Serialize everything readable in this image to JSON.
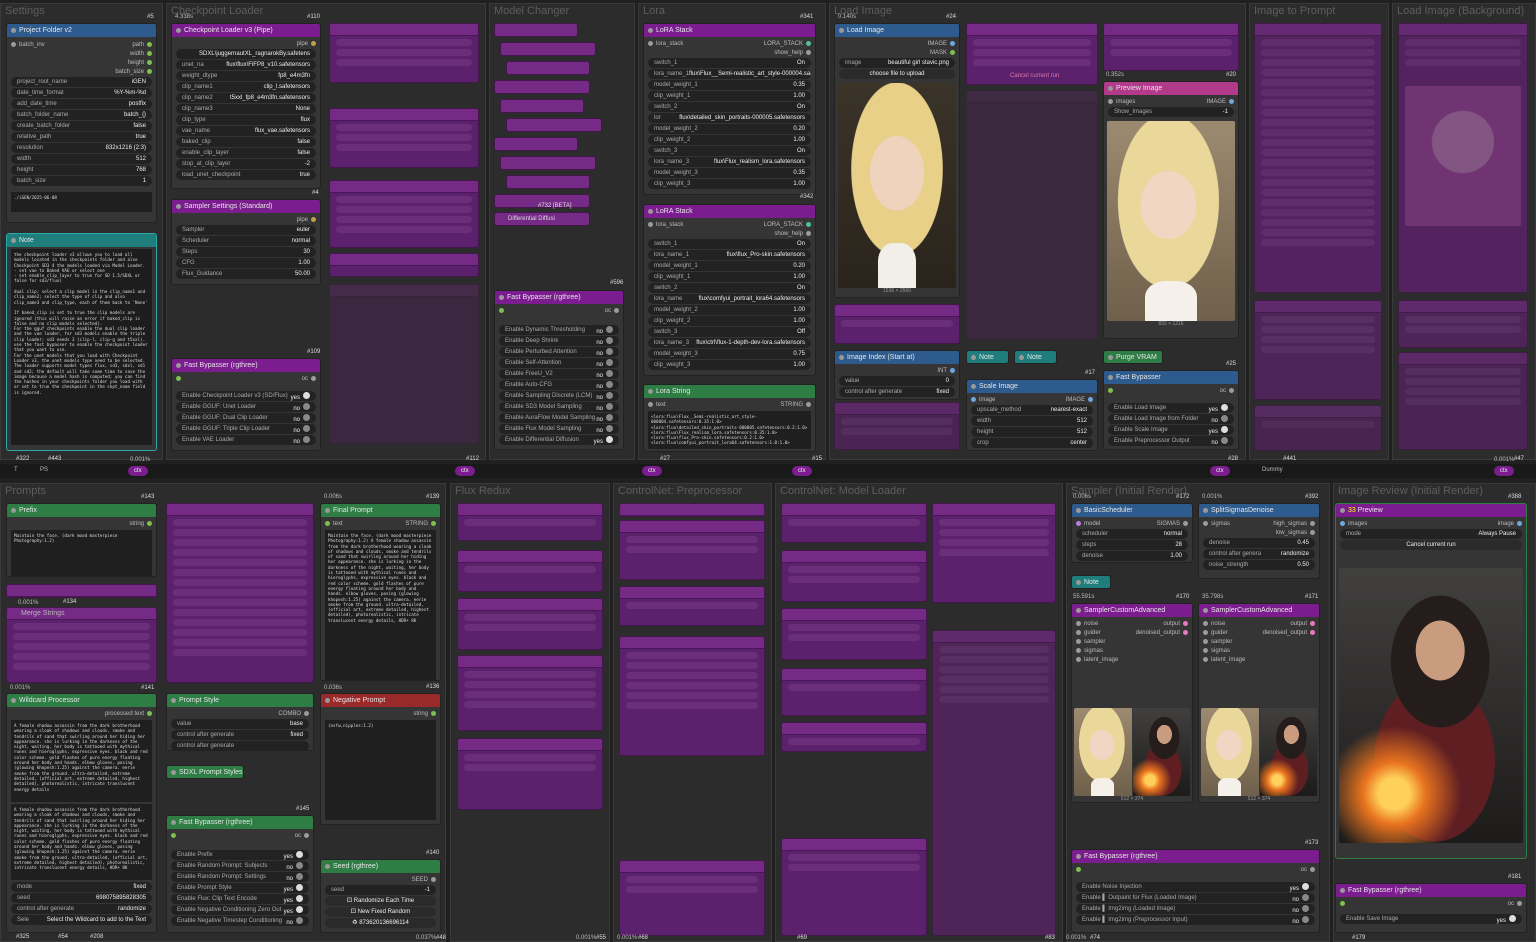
{
  "groups": {
    "settings": "Settings",
    "checkpoint_loader": "Checkpoint Loader",
    "model_changer": "Model Changer",
    "lora": "Lora",
    "load_image": "Load Image",
    "image_to_prompt": "Image to Prompt",
    "load_image_bg": "Load Image (Background)",
    "prompts": "Prompts",
    "flux_redux": "Flux Redux",
    "controlnet_pre": "ControlNet: Preprocessor",
    "controlnet_loader": "ControlNet: Model Loader",
    "sampler_initial": "Sampler (Initial Render)",
    "image_review": "Image Review (Initial Render)"
  },
  "project_folder": {
    "title": "Project Folder v2",
    "badge": "#5",
    "outputs": [
      "path",
      "width",
      "height",
      "batch_size"
    ],
    "input": "batch_inv",
    "widgets": [
      {
        "k": "project_root_name",
        "v": "iGEN"
      },
      {
        "k": "date_time_format",
        "v": "%Y-%m-%d"
      },
      {
        "k": "add_date_time",
        "v": "postfix"
      },
      {
        "k": "batch_folder_name",
        "v": "batch_{}"
      },
      {
        "k": "create_batch_folder",
        "v": "false"
      },
      {
        "k": "relative_path",
        "v": "true"
      },
      {
        "k": "resolution",
        "v": "832x1216 (2:3)"
      },
      {
        "k": "width",
        "v": "512"
      },
      {
        "k": "height",
        "v": "768"
      },
      {
        "k": "batch_size",
        "v": "1"
      }
    ],
    "path_preview": "./iGEN/2025-06-08"
  },
  "note_left": {
    "title": "Note",
    "text": "the checkpoint loader v3 allows you to load all models located in the checkpoints folder and also Checkpoint SD3 4 the models loaded via Model Loader.\n- set vae to Baked VAE or select one\n- set enable_clip_layer to true for SD 1.5/SDXL or false for sd3/flux)\n\ndual clip: select a clip model in the clip_name1 and clip_name2; select the type of clip and also clip_name3 and clip_type, each of them back to 'None'\n\nIf baked_clip is set to true the clip models are ignored (this will raise an error if baked_clip is false and no clip models selected).\nFor the gguf checkpoints enable the dual clip loader and the vae loader, for sd3 models enable the triple clip loader; sd3 needs 3 (clip-l, clip-g and t5xxl).\nuse the fast bypasser to enable the checkpoint loader that you want to use.\nFor the unet models that you load with Checkpoint Loader v3, the unet models type need to be selected.\nThe loader supports model types flux, sd3, sdxl, sd1 and sd2; the default will take some time to save the image because a model hash is computed; you can find the hashes in your checkpoints folder you load with or set to true the checkpoint in the ckpt_name field is ignored.",
    "badge_a": "#322",
    "badge_b": "#443"
  },
  "checkpoint_loader": {
    "title": "Checkpoint Loader v3 (Pipe)",
    "badge": "#110",
    "out": "pipe",
    "widgets": [
      {
        "k": "",
        "v": "SDXL\\juggernautXL_ragnarokBy.safetens"
      },
      {
        "k": "unet_na",
        "v": "flux\\flux\\FiFP8_v10.safetensors"
      },
      {
        "k": "weight_dtype",
        "v": "fp8_e4m3fn"
      },
      {
        "k": "clip_name1",
        "v": "clip_l.safetensors"
      },
      {
        "k": "clip_name2",
        "v": "t5xxl_fp8_e4m3fn.safetensors"
      },
      {
        "k": "clip_name3",
        "v": "None"
      },
      {
        "k": "clip_type",
        "v": "flux"
      },
      {
        "k": "vae_name",
        "v": "flux_vae.safetensors"
      },
      {
        "k": "baked_clip",
        "v": "false"
      },
      {
        "k": "enable_clip_layer",
        "v": "false"
      },
      {
        "k": "stop_at_clip_layer",
        "v": "-2"
      },
      {
        "k": "load_unet_checkpoint",
        "v": "true"
      }
    ],
    "badge2": "#4",
    "time": "4.338s"
  },
  "sampler_settings": {
    "title": "Sampler Settings (Standard)",
    "out": "pipe",
    "widgets": [
      {
        "k": "Sampler",
        "v": "euler"
      },
      {
        "k": "Scheduler",
        "v": "normal"
      },
      {
        "k": "Steps",
        "v": "30"
      },
      {
        "k": "CFG",
        "v": "1.00"
      },
      {
        "k": "Flux_Guidance",
        "v": "50.00"
      }
    ],
    "badge": "#109"
  },
  "fast_bypasser_1": {
    "title": "Fast Bypasser (rgthree)",
    "out": "oc",
    "items": [
      {
        "k": "Enable Checkpoint Loader v3 (SD/Flux)",
        "v": "yes"
      },
      {
        "k": "Enable GGUF: Unet Loader",
        "v": "no"
      },
      {
        "k": "Enable GGUF: Dual Clip Loader",
        "v": "no"
      },
      {
        "k": "Enable GGUF: Triple Clip Loader",
        "v": "no"
      },
      {
        "k": "Enable VAE Loader",
        "v": "no"
      }
    ],
    "badge": "#112"
  },
  "model_changer": {
    "badges": [
      "#732 [BETA]",
      "#596"
    ],
    "diff": "Differential Diffusi"
  },
  "fast_bypasser_2": {
    "title": "Fast Bypasser (rgthree)",
    "out": "oc",
    "items": [
      {
        "k": "Enable Dynamic Thresholding",
        "v": "no"
      },
      {
        "k": "Enable Deep Shrink",
        "v": "no"
      },
      {
        "k": "Enable Perturbed Attention",
        "v": "no"
      },
      {
        "k": "Enable Self-Attention",
        "v": "no"
      },
      {
        "k": "Enable FreeU_V2",
        "v": "no"
      },
      {
        "k": "Enable Auto-CFG",
        "v": "no"
      },
      {
        "k": "Enable Sampling Discrete (LCM)",
        "v": "no"
      },
      {
        "k": "Enable SD3 Model Sampling",
        "v": "no"
      },
      {
        "k": "Enable AuraFlow Model Sampling",
        "v": "no"
      },
      {
        "k": "Enable Flux Model Sampling",
        "v": "no"
      },
      {
        "k": "Enable Differential Diffusion",
        "v": "yes"
      }
    ],
    "badge": "#27"
  },
  "lora_stack_1": {
    "title": "LoRA Stack",
    "badge": "#341",
    "in": "lora_stack",
    "out": "LORA_STACK",
    "out2": "show_help",
    "widgets": [
      {
        "k": "switch_1",
        "v": "On"
      },
      {
        "k": "lora_name_1",
        "v": "flux\\Flux__Semi-realistic_art_style-000004.safetens"
      },
      {
        "k": "model_weight_1",
        "v": "0.35"
      },
      {
        "k": "clip_weight_1",
        "v": "1.00"
      },
      {
        "k": "switch_2",
        "v": "On"
      },
      {
        "k": "lor",
        "v": "flux\\detailed_skin_portraits-000005.safetensors"
      },
      {
        "k": "model_weight_2",
        "v": "0.20"
      },
      {
        "k": "clip_weight_2",
        "v": "1.00"
      },
      {
        "k": "switch_3",
        "v": "On"
      },
      {
        "k": "lora_name_3",
        "v": "flux\\Flux_realism_lora.safetensors"
      },
      {
        "k": "model_weight_3",
        "v": "0.35"
      },
      {
        "k": "clip_weight_3",
        "v": "1.00"
      }
    ]
  },
  "lora_stack_2": {
    "title": "LoRA Stack",
    "badge": "#342",
    "in": "lora_stack",
    "out": "LORA_STACK",
    "out2": "show_help",
    "widgets": [
      {
        "k": "switch_1",
        "v": "On"
      },
      {
        "k": "lora_name_1",
        "v": "flux\\flux_Pro-skin.safetensors"
      },
      {
        "k": "model_weight_1",
        "v": "0.20"
      },
      {
        "k": "clip_weight_1",
        "v": "1.00"
      },
      {
        "k": "switch_2",
        "v": "On"
      },
      {
        "k": "lora_name",
        "v": "flux\\comfyui_portrait_lora64.safetensors"
      },
      {
        "k": "model_weight_2",
        "v": "1.00"
      },
      {
        "k": "clip_weight_2",
        "v": "1.00"
      },
      {
        "k": "switch_3",
        "v": "Off"
      },
      {
        "k": "lora_name_3",
        "v": "flux\\ctrl\\flux-1-depth-dev-lora.safetensors"
      },
      {
        "k": "model_weight_3",
        "v": "0.75"
      },
      {
        "k": "clip_weight_3",
        "v": "1.00"
      }
    ]
  },
  "lora_string": {
    "title": "Lora String",
    "out": "STRING",
    "in": "text",
    "text": "<lora:flux\\Flux__Semi-realistic_art_style-000004.safetensors:0.35:1.0>\n<lora:flux\\detailed_skin_portraits-000005.safetensors:0.2:1.0>\n<lora:flux\\Flux_realism_lora.safetensors:0.35:1.0>\n<lora:flux\\flux_Pro-skin.safetensors:0.2:1.0>\n<lora:flux\\comfyui_portrait_lora64.safetensors:1.0:1.0>",
    "badge": "#15"
  },
  "load_image": {
    "title": "Load Image",
    "badge": "#24",
    "outs": [
      "IMAGE",
      "MASK"
    ],
    "image": "beautiful girl stavic.png",
    "upload": "choose file to upload",
    "dims": "1536 × 2560",
    "time": "0.140s"
  },
  "preview_image": {
    "title": "Preview Image",
    "badge": "#20",
    "in": "images",
    "out": "IMAGE",
    "show": "Show_Images",
    "show_v": "-1",
    "dims": "832 × 1216",
    "time": "0.352s",
    "cancel": "Cancel current run"
  },
  "image_index": {
    "title": "Image Index (Start at)",
    "out": "INT",
    "w": [
      {
        "k": "value",
        "v": "0"
      },
      {
        "k": "control after generate",
        "v": "fixed"
      }
    ]
  },
  "notes_mid": [
    "Note",
    "Note"
  ],
  "purge": "Purge VRAM",
  "scale_image": {
    "title": "Scale Image",
    "badge": "#17",
    "in": "image",
    "out": "IMAGE",
    "widgets": [
      {
        "k": "upscale_method",
        "v": "nearest-exact"
      },
      {
        "k": "width",
        "v": "512"
      },
      {
        "k": "height",
        "v": "512"
      },
      {
        "k": "crop",
        "v": "center"
      }
    ]
  },
  "fast_bypasser_3": {
    "title": "Fast Bypasser",
    "badge": "#25",
    "out": "oc",
    "items": [
      {
        "k": "Enable Load Image",
        "v": "yes"
      },
      {
        "k": "Enable Load Image from Folder",
        "v": "no"
      },
      {
        "k": "Enable Scale Image",
        "v": "yes"
      },
      {
        "k": "Enable Preprocessor Output",
        "v": "no"
      }
    ],
    "badge2": "#28"
  },
  "sep_top": {
    "left": [
      "T",
      "PS"
    ],
    "ctx": "ctx",
    "dummy": "Dummy",
    "badges": [
      "#441",
      "#47"
    ],
    "pct": "0.001%"
  },
  "prefix": {
    "title": "Prefix",
    "badge": "#143",
    "out": "string",
    "text": "Maintain the face. (dark mood masterpiece Photography:1.2)"
  },
  "merge": {
    "title": "Merge Strings",
    "badge": "#134",
    "pct": "0.001%"
  },
  "final_prompt": {
    "title": "Final Prompt",
    "badge": "#139",
    "in": "text",
    "out": "STRING",
    "time": "0.006s",
    "text": "Maintain the face. (dark mood masterpiece Photography:1.2) A female shadow assassin from the dark brotherhood wearing a cloak of shadows and clouds, smoke and tendrils of sand that swirling around her hiding her appearance. she is lurking in the darkness of the night, waiting, her body is tattooed with mythical runes and hieroglyphs, expressive eyes. black and red color scheme. gold flashes of pure energy floating around her body and hands. elbow gloves, posing (glowing khopesh:1.25) against the camera. eerie smoke from the ground. ultra-detailed, (official art, extreme detailed, highest detailed), photorealistic, intricate translucent energy details, HDR+ 8K"
  },
  "wildcard": {
    "title": "Wildcard Processor",
    "out": "processed text",
    "badge": "#141",
    "text1": "A female shadow assassin from the dark brotherhood wearing a cloak of shadows and clouds, smoke and tendrils of sand that swirling around her hiding her appearance. she is lurking in the darkness of the night, waiting, her body is tattooed with mythical runes and hieroglyphs, expressive eyes. black and red color scheme. gold flashes of pure energy floating around her body and hands. elbow gloves, posing (glowing khopesh:1.25) against the camera. eerie smoke from the ground. ultra-detailed, extreme detailed, (official art, extreme detailed, highest detailed), photorealistic, intricate translucent energy details",
    "text2": "A female shadow assassin from the dark brotherhood wearing a cloak of shadows and clouds, smoke and tendrils of sand that swirling around her hiding her appearance. she is lurking in the darkness of the night, waiting, her body is tattooed with mythical runes and hieroglyphs, expressive eyes. black and red color scheme. gold flashes of pure energy floating around her body and hands. elbow gloves, posing (glowing khopesh:1.25) against the camera. eerie smoke from the ground. ultra-detailed, (official art, extreme detailed, highest detailed), photorealistic, intricate translucent energy details, HDR+ 8K",
    "widgets": [
      {
        "k": "mode",
        "v": "fixed"
      },
      {
        "k": "seed",
        "v": "698075895828305"
      },
      {
        "k": "control after generate",
        "v": "randomize"
      },
      {
        "k": "Sele",
        "v": "Select the Wildcard to add to the Text"
      }
    ],
    "badges": [
      "#325",
      "#54",
      "#208"
    ],
    "pct": "0.001%"
  },
  "prompt_style": {
    "title": "Prompt Style",
    "out": "COMBO",
    "widgets": [
      {
        "k": "value",
        "v": "base"
      },
      {
        "k": "control after generate",
        "v": "fixed"
      },
      {
        "k": "control after generate",
        "v": ""
      }
    ]
  },
  "sdxl_styles": "SDXL Prompt Styles",
  "fast_bypasser_4": {
    "title": "Fast Bypasser (rgthree)",
    "badge": "#145",
    "out": "oc",
    "items": [
      {
        "k": "Enable Prefix",
        "v": "yes"
      },
      {
        "k": "Enable Random Prompt: Subjects",
        "v": "no"
      },
      {
        "k": "Enable Random Prompt: Settings",
        "v": "no"
      },
      {
        "k": "Enable Prompt Style",
        "v": "yes"
      },
      {
        "k": "Enable Flux: Clip Text Encode",
        "v": "yes"
      },
      {
        "k": "Enable Negative Conditioning Zero Out",
        "v": "yes"
      },
      {
        "k": "Enable Negative Timestep Conditioning",
        "v": "no"
      }
    ]
  },
  "negative_prompt": {
    "title": "Negative Prompt",
    "badge": "#136",
    "out": "string",
    "time": "0.036s",
    "text": "(nsfw,nipples:1.2)"
  },
  "seed": {
    "title": "Seed (rgthree)",
    "badge": "#140",
    "out": "SEED",
    "seed_k": "seed",
    "seed_v": "-1",
    "buttons": [
      "Randomize Each Time",
      "New Fixed Random"
    ],
    "last": "873620136696114",
    "badge2": "#48",
    "pct": "0.037%"
  },
  "basic_scheduler": {
    "title": "BasicScheduler",
    "badge": "#172",
    "out": "SIGMAS",
    "in": "model",
    "widgets": [
      {
        "k": "scheduler",
        "v": "normal"
      },
      {
        "k": "steps",
        "v": "28"
      },
      {
        "k": "denoise",
        "v": "1.00"
      }
    ],
    "time": "0.006s"
  },
  "split_sigmas": {
    "title": "SplitSigmasDenoise",
    "badge": "#392",
    "in": "sigmas",
    "outs": [
      "high_sigmas",
      "low_sigmas"
    ],
    "widgets": [
      {
        "k": "denoise",
        "v": "0.45"
      },
      {
        "k": "control after genera",
        "v": "randomize"
      },
      {
        "k": "noise_strength",
        "v": "0.50"
      }
    ],
    "time": "0.001%"
  },
  "note_sampler": "Note",
  "sca1": {
    "title": "SamplerCustomAdvanced",
    "badge": "#170",
    "ins": [
      "noise",
      "guider",
      "sampler",
      "sigmas",
      "latent_image"
    ],
    "outs": [
      "output",
      "denoised_output"
    ],
    "dims": "512 × 374",
    "time": "55.591s"
  },
  "sca2": {
    "title": "SamplerCustomAdvanced",
    "badge": "#171",
    "ins": [
      "noise",
      "guider",
      "sampler",
      "sigmas",
      "latent_image"
    ],
    "outs": [
      "output",
      "denoised_output"
    ],
    "dims": "512 × 374",
    "time": "35.798s"
  },
  "fast_bypasser_5": {
    "title": "Fast Bypasser (rgthree)",
    "badge": "#173",
    "out": "oc",
    "items": [
      {
        "k": "Enable Noise Injection",
        "v": "yes"
      },
      {
        "k": "Enable ▌ Outpaint for Flux (Loaded Image)",
        "v": "no"
      },
      {
        "k": "Enable ▌ Img2img (Loaded Image)",
        "v": "no"
      },
      {
        "k": "Enable ▌ Img2img (Preprocessor Input)",
        "v": "no"
      }
    ],
    "badge2": "#74",
    "pct": "0.001%"
  },
  "preview": {
    "title": "Preview",
    "badge": "#388",
    "in": "images",
    "out": "image",
    "mode_k": "mode",
    "mode_v": "Always Pause",
    "cancel": "Cancel current run"
  },
  "fast_bypasser_6": {
    "title": "Fast Bypasser (rgthree)",
    "badge": "#181",
    "out": "oc",
    "items": [
      {
        "k": "Enable Save Image",
        "v": "yes"
      }
    ],
    "badge2": "#179"
  },
  "bottom_badges": {
    "b55": "#55",
    "b68": "#68",
    "b69": "#69",
    "b83": "#83",
    "pct1": "0.001%",
    "pct2": "0.001%"
  },
  "colors": {
    "purple": "#7b1d8f",
    "blue": "#2d5b8e",
    "green": "#2e7d45",
    "teal": "#1f7e7c",
    "red": "#9a2a2a"
  }
}
